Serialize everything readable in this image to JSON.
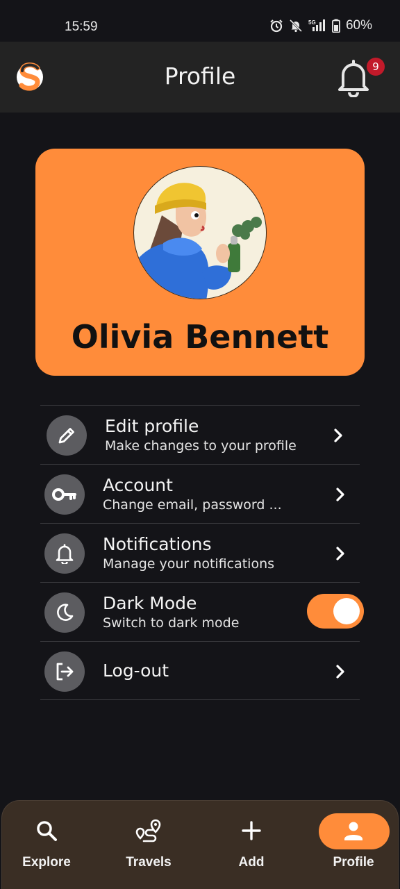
{
  "status_bar": {
    "time": "15:59",
    "battery": "60%",
    "network": "5G"
  },
  "app_bar": {
    "title": "Profile",
    "notification_count": "9"
  },
  "profile": {
    "name": "Olivia Bennett"
  },
  "settings": {
    "edit_profile": {
      "title": "Edit profile",
      "subtitle": "Make changes to your profile",
      "icon": "pencil-icon"
    },
    "account": {
      "title": "Account",
      "subtitle": "Change email, password ...",
      "icon": "key-icon"
    },
    "notifications": {
      "title": "Notifications",
      "subtitle": "Manage your notifications",
      "icon": "bell-icon"
    },
    "dark_mode": {
      "title": "Dark Mode",
      "subtitle": "Switch to dark mode",
      "icon": "moon-icon",
      "enabled": true
    },
    "logout": {
      "title": "Log-out",
      "icon": "logout-icon"
    }
  },
  "bottom_nav": {
    "items": [
      {
        "label": "Explore",
        "icon": "search-icon"
      },
      {
        "label": "Travels",
        "icon": "route-icon"
      },
      {
        "label": "Add",
        "icon": "plus-icon"
      },
      {
        "label": "Profile",
        "icon": "person-icon",
        "active": true
      }
    ]
  },
  "colors": {
    "accent": "#ff8c3a",
    "background": "#141418",
    "app_bar": "#232323",
    "badge": "#c21a2a",
    "nav_background": "#3a2e24"
  }
}
